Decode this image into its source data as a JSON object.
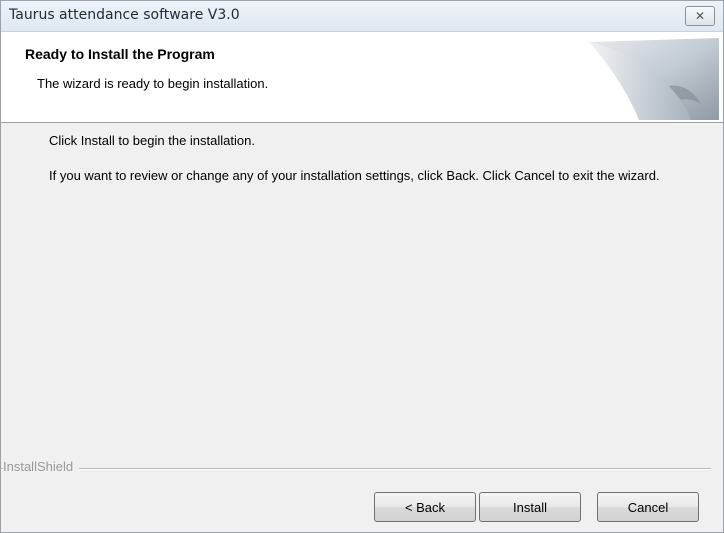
{
  "window": {
    "title": "Taurus attendance software V3.0",
    "close_symbol": "✕"
  },
  "header": {
    "title": "Ready to Install the Program",
    "subtitle": "The wizard is ready to begin installation."
  },
  "content": {
    "line1": "Click Install to begin the installation.",
    "line2": "If you want to review or change any of your installation settings, click Back. Click Cancel to exit the wizard."
  },
  "footer": {
    "brand": "InstallShield",
    "buttons": {
      "back": "< Back",
      "install": "Install",
      "cancel": "Cancel"
    }
  },
  "colors": {
    "window_bg": "#f0f0f0",
    "header_bg": "#ffffff",
    "brand_text": "#9a9a9a"
  },
  "icons": [
    "close-icon",
    "wizard-page-curl-graphic"
  ]
}
